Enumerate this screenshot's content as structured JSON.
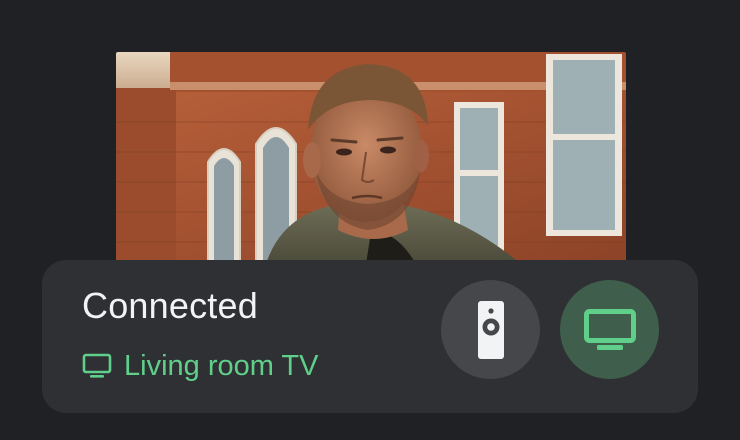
{
  "video": {
    "description_icon": "video-thumbnail"
  },
  "connection": {
    "status": "Connected",
    "device_name": "Living room TV",
    "device_icon": "tv-icon"
  },
  "actions": {
    "remote_icon": "remote-control-icon",
    "cast_icon": "tv-icon"
  },
  "colors": {
    "background": "#202124",
    "card": "#2f3034",
    "accent_green": "#5fcf8a",
    "remote_button": "#45474a",
    "cast_button": "#3f5e4b"
  }
}
